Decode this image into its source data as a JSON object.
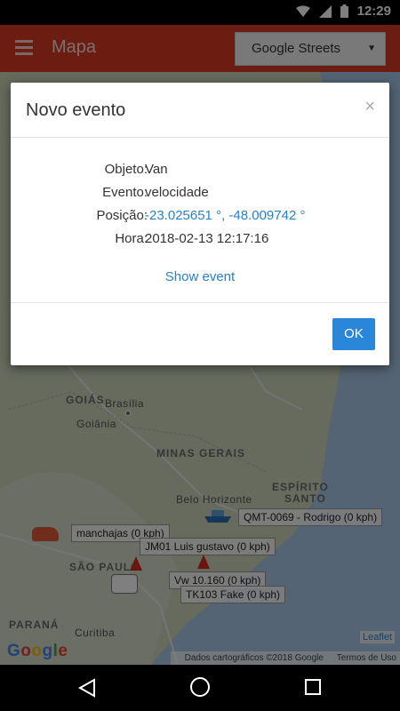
{
  "status": {
    "time": "12:29"
  },
  "appbar": {
    "title": "Mapa",
    "layer_select": "Google Streets"
  },
  "map": {
    "labels": {
      "brasilia": "Brasília",
      "goias": "GOIÁS",
      "goiania": "Goiânia",
      "minas": "MINAS GERAIS",
      "bh": "Belo Horizonte",
      "es1": "ESPÍRITO",
      "es2": "SANTO",
      "sp": "SÃO PAULO",
      "parana": "PARANÁ",
      "curitiba": "Curitiba"
    },
    "vehicles": [
      {
        "label": "QMT-0069 - Rodrigo (0 kph)"
      },
      {
        "label": "manchajas (0 kph)"
      },
      {
        "label": "JM01 Luis gustavo (0 kph)"
      },
      {
        "label": "Vw 10.160 (0 kph)"
      },
      {
        "label": "TK103 Fake (0 kph)"
      }
    ],
    "attribution_data": "Dados cartográficos ©2018 Google",
    "attribution_terms": "Termos de Uso",
    "leaflet": "Leaflet",
    "google": "Google"
  },
  "dialog": {
    "title": "Novo evento",
    "close": "×",
    "fields": [
      {
        "key": "Objeto:",
        "value": "Van"
      },
      {
        "key": "Evento:",
        "value": "velocidade"
      },
      {
        "key": "Posição:",
        "value": "-23.025651 °, -48.009742 °"
      },
      {
        "key": "Hora:",
        "value": "2018-02-13 12:17:16"
      }
    ],
    "show_event": "Show event",
    "ok": "OK"
  },
  "colors": {
    "appbar": "#d63a25",
    "link": "#2a80c8",
    "ok_button": "#2a86d8"
  }
}
